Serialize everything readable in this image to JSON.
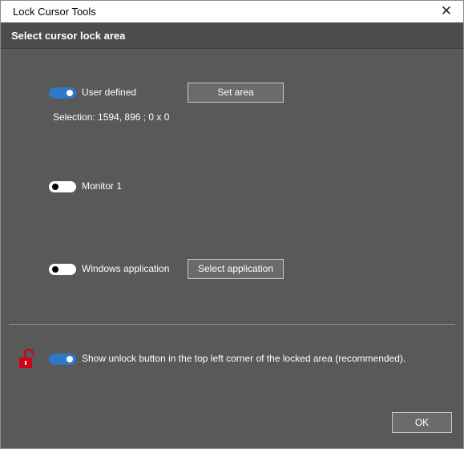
{
  "window": {
    "title": "Lock Cursor Tools",
    "close_glyph": "✕"
  },
  "header": {
    "title": "Select cursor lock area"
  },
  "options": {
    "user_defined": {
      "label": "User defined",
      "enabled": true,
      "button": "Set area",
      "selection": "Selection: 1594, 896 ;  0 x 0"
    },
    "monitor": {
      "label": "Monitor 1",
      "enabled": false
    },
    "windows_app": {
      "label": "Windows application",
      "enabled": false,
      "button": "Select application"
    }
  },
  "unlock": {
    "label": "Show unlock button in the top left corner of the locked area (recommended).",
    "enabled": true,
    "icon": "unlocked-padlock-icon",
    "icon_color": "#d0021b"
  },
  "footer": {
    "ok_label": "OK"
  },
  "colors": {
    "toggle_on": "#2e78c8",
    "background": "#595959",
    "header": "#4c4c4c"
  }
}
